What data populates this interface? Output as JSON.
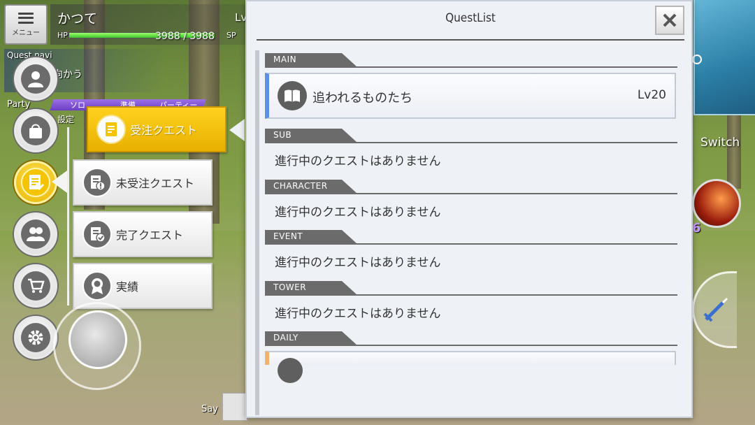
{
  "hud": {
    "menu_label": "メニュー",
    "player_name": "かつて",
    "player_lv_label": "Lv",
    "hp_label": "HP",
    "hp_value": "3988 / 3988",
    "hp_fraction": 1.0,
    "sp_label": "SP",
    "quest_nav_title": "Quest navi",
    "quest_nav_text": "向かう",
    "party_title": "Party",
    "party_tabs": [
      "ソロ",
      "準備",
      "パーティー"
    ],
    "party_settings": "設定",
    "say_label": "Say",
    "switch_label": "Switch",
    "skill_count": "6"
  },
  "sidebar": {
    "items": [
      {
        "name": "character",
        "icon": "person-icon"
      },
      {
        "name": "inventory",
        "icon": "bag-icon"
      },
      {
        "name": "quest",
        "icon": "quest-note-icon",
        "active": true
      },
      {
        "name": "friends",
        "icon": "friends-icon"
      },
      {
        "name": "shop",
        "icon": "cart-icon"
      },
      {
        "name": "settings",
        "icon": "gear-icon"
      }
    ]
  },
  "submenu": {
    "items": [
      {
        "label": "受注クエスト",
        "icon": "quest-note-icon",
        "active": true
      },
      {
        "label": "未受注クエスト",
        "icon": "quest-pending-icon"
      },
      {
        "label": "完了クエスト",
        "icon": "quest-done-icon"
      },
      {
        "label": "実績",
        "icon": "medal-icon"
      }
    ]
  },
  "quest_list": {
    "title": "QuestList",
    "close_icon": "close-icon",
    "sections": [
      {
        "label": "MAIN",
        "quests": [
          {
            "name": "追われるものたち",
            "level": "Lv20",
            "icon": "book-icon"
          }
        ]
      },
      {
        "label": "SUB",
        "empty_text": "進行中のクエストはありません"
      },
      {
        "label": "CHARACTER",
        "empty_text": "進行中のクエストはありません"
      },
      {
        "label": "EVENT",
        "empty_text": "進行中のクエストはありません"
      },
      {
        "label": "TOWER",
        "empty_text": "進行中のクエストはありません"
      },
      {
        "label": "DAILY"
      }
    ]
  },
  "colors": {
    "active_yellow": "#f4c400",
    "main_quest_accent": "#5b8fe8",
    "daily_quest_accent": "#f0b46a",
    "hp_green": "#3fc52e",
    "party_purple": "#6b3fc2"
  }
}
